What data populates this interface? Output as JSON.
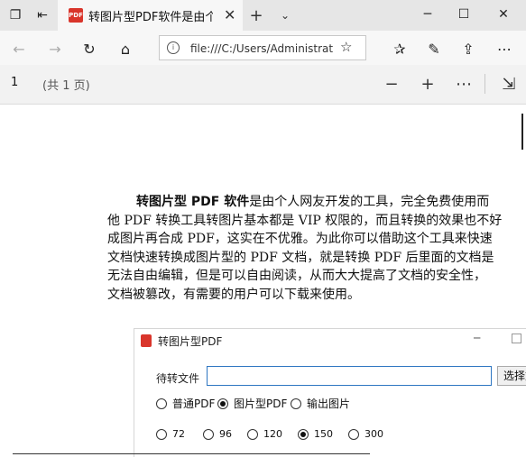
{
  "browser": {
    "tab_title": "转图片型PDF软件是由个人网友开发的工具",
    "tab_badge": "PDF",
    "address": "file:///C:/Users/Administrator/Desktop/转图片型PDF.pdf"
  },
  "pdf_toolbar": {
    "page_number": "1",
    "page_total": "(共 1 页)"
  },
  "document": {
    "lines": [
      {
        "bold": "转图片型 PDF 软件",
        "text": "是由个人网友开发的工具，完全免费使用而"
      },
      {
        "bold": "",
        "text": "他 PDF 转换工具转图片基本都是 VIP 权限的，而且转换的效果也不好"
      },
      {
        "bold": "",
        "text": "成图片再合成 PDF，这实在不优雅。为此你可以借助这个工具来快速"
      },
      {
        "bold": "",
        "text": "文档快速转换成图片型的 PDF 文档，就是转换 PDF 后里面的文档是"
      },
      {
        "bold": "",
        "text": "无法自由编辑，但是可以自由阅读，从而大大提高了文档的安全性，"
      },
      {
        "bold": "",
        "text": "文档被篡改，有需要的用户可以下载来使用。"
      }
    ]
  },
  "app_window": {
    "title": "转图片型PDF",
    "file_label": "待转文件",
    "file_value": "",
    "select_button": "选择文件",
    "modes": [
      {
        "label": "普通PDF",
        "selected": false
      },
      {
        "label": "图片型PDF",
        "selected": true
      },
      {
        "label": "输出图片",
        "selected": false
      }
    ],
    "dpi_options": [
      {
        "label": "72",
        "selected": false
      },
      {
        "label": "96",
        "selected": false
      },
      {
        "label": "120",
        "selected": false
      },
      {
        "label": "150",
        "selected": true
      },
      {
        "label": "300",
        "selected": false
      }
    ]
  }
}
